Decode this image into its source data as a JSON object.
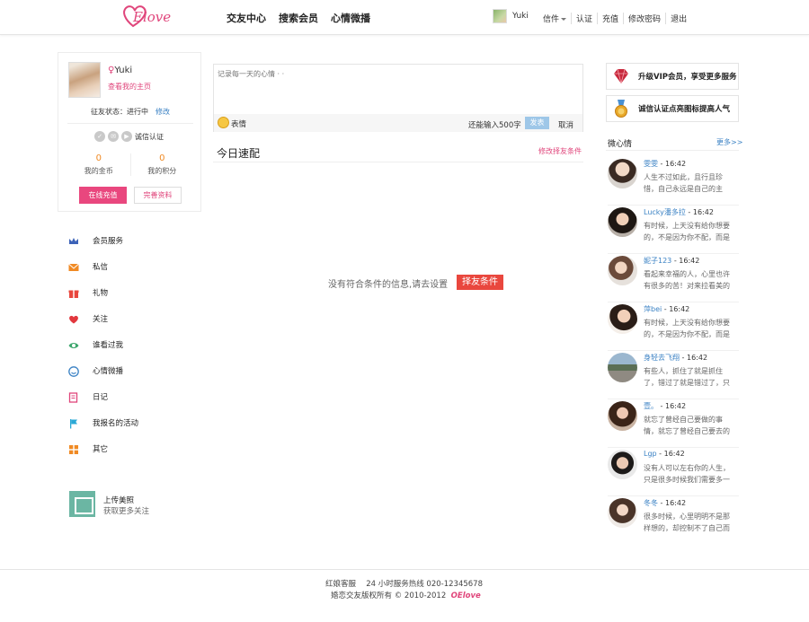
{
  "brand": {
    "logo_text": "Elove",
    "accent": "#e0457b"
  },
  "nav": {
    "items": [
      "交友中心",
      "搜索会员",
      "心情微播"
    ]
  },
  "header": {
    "username": "Yuki",
    "links": [
      "信件",
      "认证",
      "充值",
      "修改密码",
      "退出"
    ]
  },
  "profile": {
    "name": "Yuki",
    "home_link": "查看我的主页",
    "status_label": "征友状态：进行中",
    "status_edit": "修改",
    "cert_label": "诚信认证",
    "coins_value": "0",
    "coins_label": "我的金币",
    "points_value": "0",
    "points_label": "我的积分",
    "recharge_btn": "在线充值",
    "complete_btn": "完善资料"
  },
  "menu": [
    {
      "label": "会员服务",
      "icon": "crown-icon",
      "color": "#3d63b8"
    },
    {
      "label": "私信",
      "icon": "mail-icon",
      "color": "#f08a24"
    },
    {
      "label": "礼物",
      "icon": "gift-icon",
      "color": "#e9473e"
    },
    {
      "label": "关注",
      "icon": "heart-icon",
      "color": "#e2373d"
    },
    {
      "label": "谁看过我",
      "icon": "eye-icon",
      "color": "#3aa56b"
    },
    {
      "label": "心情微播",
      "icon": "smile-icon",
      "color": "#3b82c4"
    },
    {
      "label": "日记",
      "icon": "diary-icon",
      "color": "#e0457b"
    },
    {
      "label": "我报名的活动",
      "icon": "flag-icon",
      "color": "#2aa8d6"
    },
    {
      "label": "其它",
      "icon": "grid-icon",
      "color": "#f08a24"
    }
  ],
  "upload": {
    "title": "上传美照",
    "subtitle": "获取更多关注"
  },
  "composer": {
    "placeholder": "记录每一天的心情 · ·",
    "emoji_label": "表情",
    "remaining": "还能输入500字",
    "publish": "发表",
    "cancel": "取消"
  },
  "match": {
    "title": "今日速配",
    "edit_link": "修改择友条件",
    "empty_message": "没有符合条件的信息,请去设置",
    "empty_button": "择友条件"
  },
  "side": {
    "vip_text": "升级VIP会员，享受更多服务",
    "cert_text": "诚信认证点亮图标提高人气",
    "mood_title": "微心情",
    "mood_more": "更多>>"
  },
  "moods": [
    {
      "name": "雯雯",
      "time": "16:42",
      "text": "人生不过如此，且行且珍惜，自己永远是自己的主角，不要"
    },
    {
      "name": "Lucky潘多拉",
      "time": "16:42",
      "text": "有时候，上天没有给你想要的，不是因为你不配，而是你"
    },
    {
      "name": "妮子123",
      "time": "16:42",
      "text": "看起来幸福的人，心里也许有很多的苦！对来拉看美的人，"
    },
    {
      "name": "萍bei",
      "time": "16:42",
      "text": "有时候，上天没有给你想要的，不是因为你不配，而是你"
    },
    {
      "name": "身轻去飞翔",
      "time": "16:42",
      "text": "有些人，抓住了就是抓住了，错过了就是错过了，只能珍惜"
    },
    {
      "name": "壹。",
      "time": "16:42",
      "text": "就忘了曾经自己要做的事情，就忘了曾经自己要去的地方，"
    },
    {
      "name": "Lgp",
      "time": "16:42",
      "text": "没有人可以左右你的人生，只是很多时候我们需要多一些勇"
    },
    {
      "name": "冬冬",
      "time": "16:42",
      "text": "很多时候，心里明明不是那样想的，却控制不了自己而说出"
    }
  ],
  "footer": {
    "line1": "红娘客服　  24 小时服务热线 020-12345678",
    "line2": "婚恋交友版权所有 © 2010-2012",
    "brand": "OElove"
  }
}
